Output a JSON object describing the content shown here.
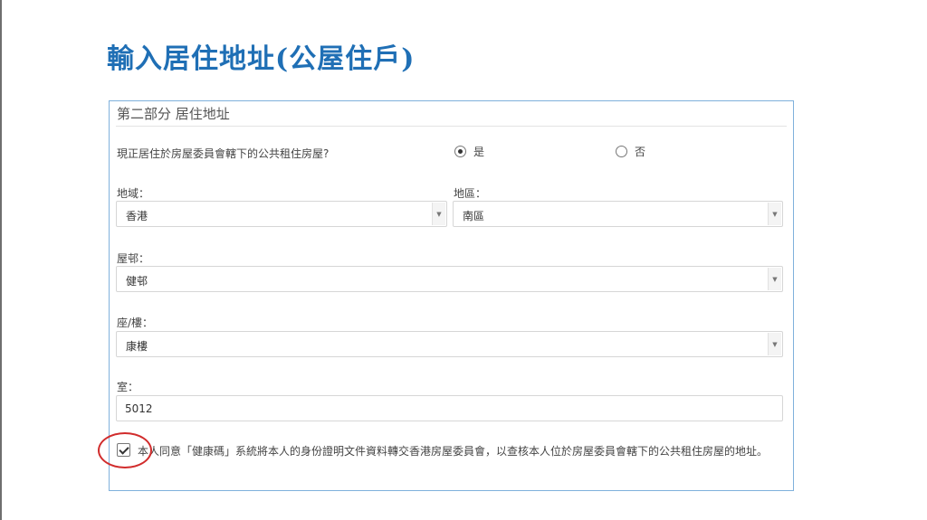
{
  "slide": {
    "title": "輸入居住地址(公屋住戶)"
  },
  "form": {
    "section_title": "第二部分 居住地址",
    "question": "現正居住於房屋委員會轄下的公共租住房屋?",
    "options": [
      {
        "label": "是",
        "selected": true
      },
      {
        "label": "否",
        "selected": false
      }
    ],
    "region": {
      "label": "地域：",
      "value": "香港"
    },
    "district": {
      "label": "地區：",
      "value": "南區"
    },
    "estate": {
      "label": "屋邨：",
      "value": "健邨"
    },
    "block": {
      "label": "座/樓：",
      "value": "康樓"
    },
    "flat": {
      "label": "室：",
      "value": "5012"
    },
    "consent": {
      "checked": true,
      "text": "本人同意「健康碼」系統將本人的身份證明文件資料轉交香港房屋委員會，以查核本人位於房屋委員會轄下的公共租住房屋的地址。"
    }
  },
  "annotation": {
    "color": "#d12c2c",
    "shape": "circle around consent checkbox"
  },
  "colors": {
    "title": "#1f6fb5",
    "panel_border": "#7fb1dc"
  }
}
